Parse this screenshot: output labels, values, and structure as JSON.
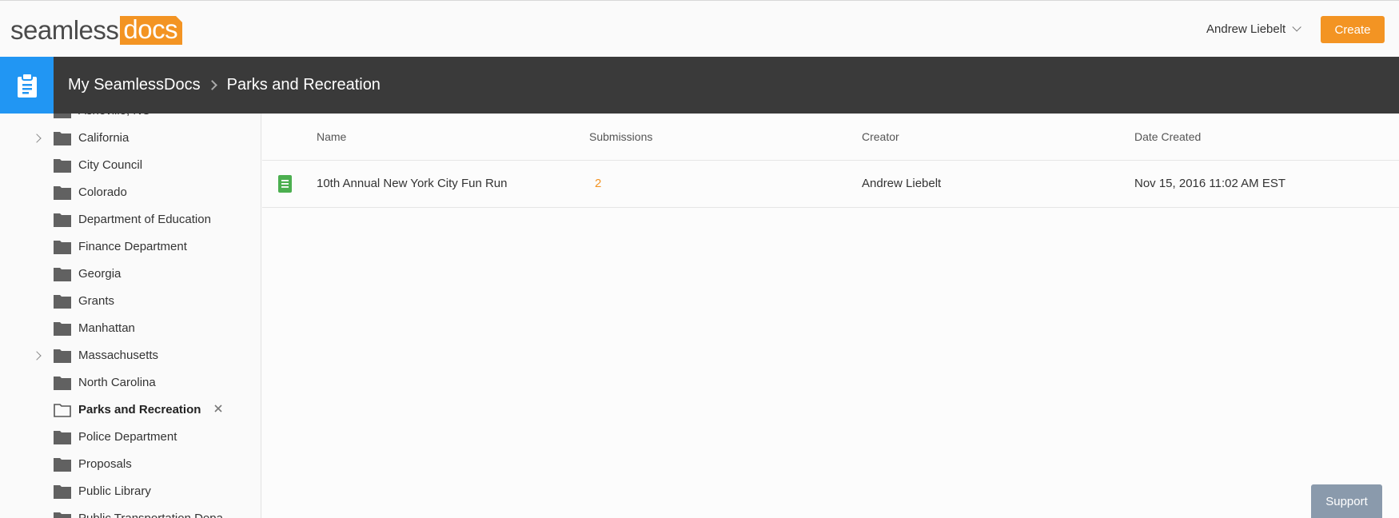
{
  "header": {
    "logo_part1": "seamless",
    "logo_part2": "docs",
    "user_name": "Andrew Liebelt",
    "create_label": "Create"
  },
  "breadcrumb": {
    "root": "My SeamlessDocs",
    "current": "Parks and Recreation"
  },
  "sidebar": {
    "items": [
      {
        "label": "Asheville, NC",
        "expandable": false
      },
      {
        "label": "California",
        "expandable": true
      },
      {
        "label": "City Council",
        "expandable": false
      },
      {
        "label": "Colorado",
        "expandable": false
      },
      {
        "label": "Department of Education",
        "expandable": false
      },
      {
        "label": "Finance Department",
        "expandable": false
      },
      {
        "label": "Georgia",
        "expandable": false
      },
      {
        "label": "Grants",
        "expandable": false
      },
      {
        "label": "Manhattan",
        "expandable": false
      },
      {
        "label": "Massachusetts",
        "expandable": true
      },
      {
        "label": "North Carolina",
        "expandable": false
      },
      {
        "label": "Parks and Recreation",
        "expandable": false,
        "active": true
      },
      {
        "label": "Police Department",
        "expandable": false
      },
      {
        "label": "Proposals",
        "expandable": false
      },
      {
        "label": "Public Library",
        "expandable": false
      },
      {
        "label": "Public Transportation Depa",
        "expandable": false
      }
    ]
  },
  "table": {
    "columns": [
      "Name",
      "Submissions",
      "Creator",
      "Date Created"
    ],
    "rows": [
      {
        "name": "10th Annual New York City Fun Run",
        "submissions": "2",
        "creator": "Andrew Liebelt",
        "date_created": "Nov 15, 2016 11:02 AM EST"
      }
    ]
  },
  "support_label": "Support",
  "colors": {
    "brand_orange": "#f39423",
    "accent_blue": "#2196f3",
    "header_dark": "#3a3a3a",
    "doc_green": "#4caf50"
  }
}
